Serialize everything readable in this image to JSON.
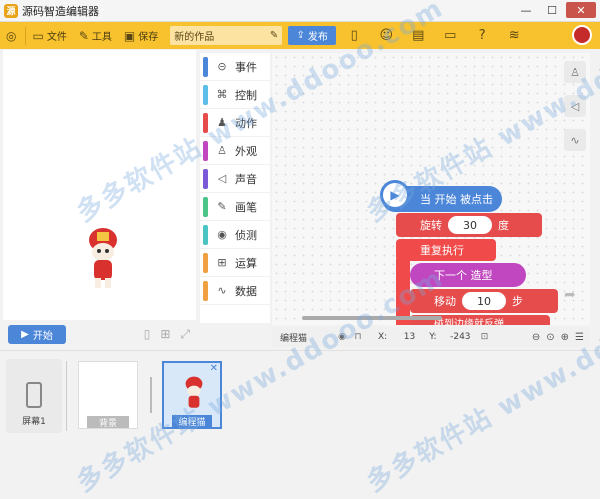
{
  "window": {
    "title": "源码智造编辑器",
    "minimize": "—",
    "maximize": "☐",
    "close": "✕"
  },
  "toolbar": {
    "file_label": "文件",
    "tools_label": "工具",
    "save_label": "保存",
    "project_name": "新的作品",
    "publish_label": "发布"
  },
  "stage": {
    "start_label": "开始"
  },
  "categories": [
    {
      "label": "事件",
      "color": "#4b86d8",
      "icon": "toggle-icon"
    },
    {
      "label": "控制",
      "color": "#5bbde8",
      "icon": "gamepad-icon"
    },
    {
      "label": "动作",
      "color": "#e64c4c",
      "icon": "runner-icon"
    },
    {
      "label": "外观",
      "color": "#c047c0",
      "icon": "shirt-icon"
    },
    {
      "label": "声音",
      "color": "#7a5ad8",
      "icon": "speaker-icon"
    },
    {
      "label": "画笔",
      "color": "#4bc48a",
      "icon": "pen-icon"
    },
    {
      "label": "侦测",
      "color": "#4bc4c4",
      "icon": "sensor-icon"
    },
    {
      "label": "运算",
      "color": "#f0a040",
      "icon": "calc-icon"
    },
    {
      "label": "数据",
      "color": "#f0a040",
      "icon": "data-icon"
    }
  ],
  "blocks": {
    "hat": "当 开始 被点击",
    "turn_label": "旋转",
    "turn_value": "30",
    "turn_unit": "度",
    "loop": "重复执行",
    "costume": "下一个 造型",
    "move_label": "移动",
    "move_value": "10",
    "move_unit": "步",
    "edge": "碰到边缘就反弹"
  },
  "infobar": {
    "sprite_name": "编程猫",
    "x_label": "X:",
    "x_value": "13",
    "y_label": "Y:",
    "y_value": "-243"
  },
  "bottom": {
    "screen_label": "屏幕1",
    "background_label": "背景",
    "sprite_label": "编程猫"
  },
  "watermark": "多多软件站 www.ddooo.com"
}
